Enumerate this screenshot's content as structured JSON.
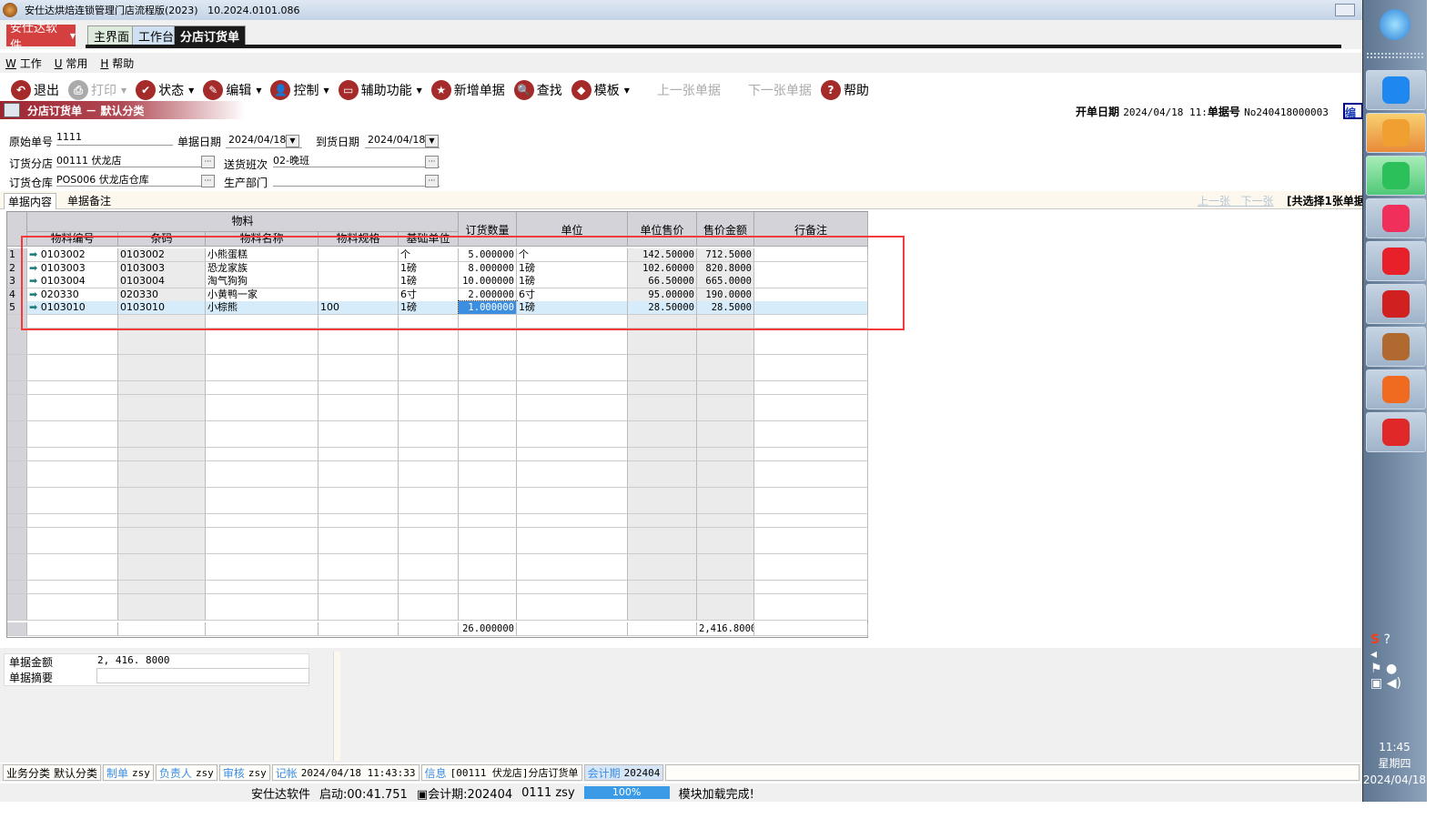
{
  "window": {
    "title": "安仕达烘焙连锁管理门店流程版(2023)",
    "version": "10.2024.0101.086"
  },
  "brand_button": "安仕达软件",
  "tabs": [
    {
      "label": "主界面"
    },
    {
      "label": "工作台"
    },
    {
      "label": "分店订货单",
      "active": true
    }
  ],
  "menu": [
    {
      "key": "W",
      "label": "工作"
    },
    {
      "key": "U",
      "label": "常用"
    },
    {
      "key": "H",
      "label": "帮助"
    }
  ],
  "toolbar": [
    {
      "label": "退出",
      "icon": "undo-icon",
      "glyph": "↶"
    },
    {
      "label": "打印",
      "icon": "printer-icon",
      "glyph": "⎙",
      "disabled": true,
      "dropdown": true
    },
    {
      "label": "状态",
      "icon": "check-icon",
      "glyph": "✔",
      "dropdown": true
    },
    {
      "label": "编辑",
      "icon": "pencil-icon",
      "glyph": "✎",
      "dropdown": true
    },
    {
      "label": "控制",
      "icon": "user-icon",
      "glyph": "👤",
      "dropdown": true
    },
    {
      "label": "辅助功能",
      "icon": "folder-icon",
      "glyph": "▭",
      "dropdown": true
    },
    {
      "label": "新增单据",
      "icon": "star-icon",
      "glyph": "★"
    },
    {
      "label": "查找",
      "icon": "search-icon",
      "glyph": "🔍"
    },
    {
      "label": "模板",
      "icon": "eraser-icon",
      "glyph": "◆",
      "dropdown": true
    },
    {
      "label": "上一张单据",
      "disabled": true
    },
    {
      "label": "下一张单据",
      "disabled": true
    },
    {
      "label": "帮助",
      "icon": "help-icon",
      "glyph": "?"
    }
  ],
  "form_title": "分店订货单 － 默认分类",
  "bill_info": {
    "open_date_label": "开单日期",
    "open_date": "2024/04/18 11:",
    "bill_no_label": "单据号",
    "bill_no": "No240418000003",
    "edit_badge": "编号"
  },
  "form": {
    "orig_no_label": "原始单号",
    "orig_no": "1111",
    "bill_date_label": "单据日期",
    "bill_date": "2024/04/18",
    "arrive_date_label": "到货日期",
    "arrive_date": "2024/04/18",
    "branch_label": "订货分店",
    "branch": "00111  伏龙店",
    "shift_label": "送货班次",
    "shift": "02-晚班",
    "warehouse_label": "订货仓库",
    "warehouse": "POS006  伏龙店仓库",
    "dept_label": "生产部门",
    "dept": ""
  },
  "subtabs": [
    "单据内容",
    "单据备注"
  ],
  "nav": {
    "prev": "上一张",
    "next": "下一张",
    "selected": "[共选择1张单据"
  },
  "grid": {
    "group_header": "物料",
    "columns": [
      "物料编号",
      "条码",
      "物料名称",
      "物料规格",
      "基础单位",
      "订货数量",
      "单位",
      "单位售价",
      "售价金额",
      "行备注"
    ],
    "rows": [
      [
        "1",
        "0103002",
        "0103002",
        "小熊蛋糕",
        "",
        "个",
        "5.000000",
        "个",
        "142.50000",
        "712.5000",
        ""
      ],
      [
        "2",
        "0103003",
        "0103003",
        "恐龙家族",
        "",
        "1磅",
        "8.000000",
        "1磅",
        "102.60000",
        "820.8000",
        ""
      ],
      [
        "3",
        "0103004",
        "0103004",
        "淘气狗狗",
        "",
        "1磅",
        "10.000000",
        "1磅",
        "66.50000",
        "665.0000",
        ""
      ],
      [
        "4",
        "020330",
        "020330",
        "小黄鸭一家",
        "",
        "6寸",
        "2.000000",
        "6寸",
        "95.00000",
        "190.0000",
        ""
      ],
      [
        "5",
        "0103010",
        "0103010",
        "小棕熊",
        "100",
        "1磅",
        "1.000000",
        "1磅",
        "28.50000",
        "28.5000",
        ""
      ]
    ],
    "selected_row": 5,
    "totals": {
      "qty": "26.000000",
      "amount": "2,416.8000"
    }
  },
  "summary": {
    "amount_label": "单据金额",
    "amount": "2, 416. 8000",
    "memo_label": "单据摘要",
    "memo": ""
  },
  "status1": [
    {
      "k": "业务分类",
      "v": "默认分类",
      "plain": true
    },
    {
      "k": "制单",
      "v": "zsy"
    },
    {
      "k": "负责人",
      "v": "zsy"
    },
    {
      "k": "审核",
      "v": "zsy"
    },
    {
      "k": "记帐",
      "v": "2024/04/18 11:43:33"
    },
    {
      "k": "信息",
      "v": "[00111 伏龙店]分店订货单"
    },
    {
      "k": "会计期",
      "v": "202404"
    }
  ],
  "status2": {
    "company": "安仕达软件",
    "startup": "启动:00:41.751",
    "period": "会计期:202404",
    "user": "0111  zsy",
    "progress": "100%",
    "message": "模块加载完成!"
  },
  "taskbar": {
    "time": "11:45",
    "weekday": "星期四",
    "date": "2024/04/18",
    "apps": [
      {
        "icon": "start-orb-icon",
        "c": "#2a7fd6"
      },
      {
        "icon": "feishu-icon",
        "c": "#1e88f0"
      },
      {
        "icon": "chat-bubble-icon",
        "c": "#f0a030"
      },
      {
        "icon": "wechat-icon",
        "c": "#2cc05a"
      },
      {
        "icon": "video-icon",
        "c": "#f0305a"
      },
      {
        "icon": "m-app-icon",
        "c": "#e8202a"
      },
      {
        "icon": "globe-app-icon",
        "c": "#d02020"
      },
      {
        "icon": "bakery-app-icon",
        "c": "#b06a30"
      },
      {
        "icon": "firefox-icon",
        "c": "#f06a20"
      },
      {
        "icon": "wps-icon",
        "c": "#e02828"
      }
    ]
  },
  "colors": {
    "accent_red": "#d44040",
    "toolbar_icon": "#a52a2a",
    "selection": "#d6ecfa",
    "annotation": "#f03c3c"
  }
}
